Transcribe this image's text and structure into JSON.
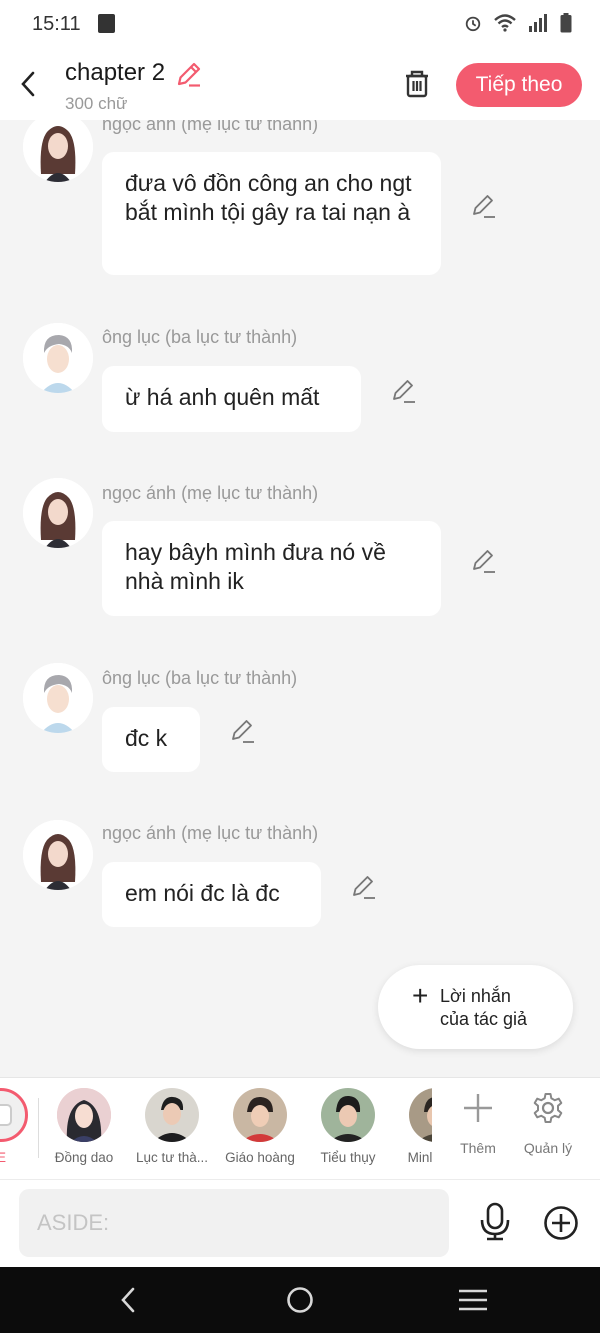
{
  "status_bar": {
    "time": "15:11"
  },
  "header": {
    "title": "chapter 2",
    "word_count": "300 chữ",
    "next_label": "Tiếp theo"
  },
  "messages": [
    {
      "speaker": "ngọc ánh (mẹ lục tư thành)",
      "text": "đưa vô đồn công an cho ngt bắt mình tội gây ra tai nạn à",
      "avatar": "woman-avatar"
    },
    {
      "speaker": "ông lục (ba lục tư thành)",
      "text": "ừ há anh quên mất",
      "avatar": "man-avatar"
    },
    {
      "speaker": "ngọc ánh (mẹ lục tư thành)",
      "text": "hay bâyh mình đưa nó về nhà mình ik",
      "avatar": "woman-avatar"
    },
    {
      "speaker": "ông lục (ba lục tư thành)",
      "text": "đc k",
      "avatar": "man-avatar"
    },
    {
      "speaker": "ngọc ánh (mẹ lục tư thành)",
      "text": "em nói đc là đc",
      "avatar": "woman-avatar"
    }
  ],
  "author_note": {
    "line1": "Lời nhắn",
    "line2": "của tác giả"
  },
  "characters": {
    "aside_partial": "DE",
    "items": [
      {
        "name": "Đồng dao"
      },
      {
        "name": "Lục tư thà..."
      },
      {
        "name": "Giáo hoàng"
      },
      {
        "name": "Tiểu thụy"
      },
      {
        "name": "Minl"
      }
    ],
    "add_label": "Thêm",
    "manage_label": "Quản lý"
  },
  "input": {
    "placeholder": "ASIDE:"
  },
  "colors": {
    "accent": "#f35b6f",
    "background": "#f4f4f4"
  }
}
